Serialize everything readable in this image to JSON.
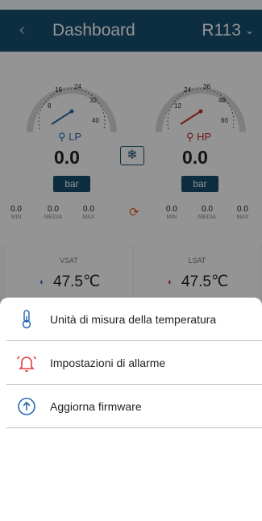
{
  "header": {
    "back_glyph": "‹",
    "title": "Dashboard",
    "refrigerant": "R113",
    "chevron": "⌄"
  },
  "gauges": {
    "lp": {
      "ticks": [
        "8",
        "16",
        "24",
        "32",
        "40"
      ],
      "label": "LP",
      "value": "0.0",
      "unit": "bar",
      "stats": [
        {
          "value": "0.0",
          "label": "MIN"
        },
        {
          "value": "0.0",
          "label": "MEDIA"
        },
        {
          "value": "0.0",
          "label": "MAX"
        }
      ],
      "needle_color": "#2b6cb0"
    },
    "hp": {
      "ticks": [
        "12",
        "24",
        "36",
        "48",
        "60"
      ],
      "label": "HP",
      "value": "0.0",
      "unit": "bar",
      "stats": [
        {
          "value": "0.0",
          "label": "MIN"
        },
        {
          "value": "0.0",
          "label": "MEDIA"
        },
        {
          "value": "0.0",
          "label": "MAX"
        }
      ],
      "needle_color": "#c53030"
    },
    "mode_icon": "snowflake-icon",
    "mode_glyph": "❄"
  },
  "saturation": {
    "vsat": {
      "label": "VSAT",
      "value": "47.5℃"
    },
    "lsat": {
      "label": "LSAT",
      "value": "47.5℃"
    }
  },
  "menu": {
    "items": [
      {
        "label": "Unità di misura della temperatura",
        "icon": "thermometer-icon"
      },
      {
        "label": "Impostazioni di allarme",
        "icon": "alarm-clock-icon"
      },
      {
        "label": "Aggiorna firmware",
        "icon": "upgrade-arrow-icon"
      }
    ]
  },
  "colors": {
    "header": "#17506f",
    "accent_blue": "#2b6cb0",
    "accent_red": "#e53e3e",
    "refresh": "#e05a1a"
  }
}
